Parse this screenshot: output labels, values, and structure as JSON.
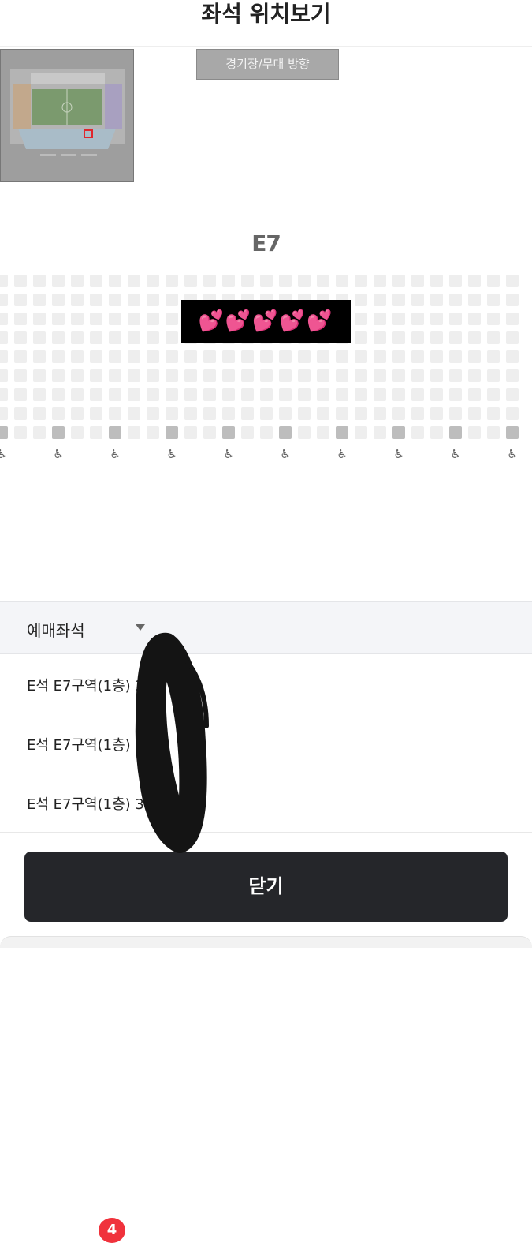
{
  "header": {
    "title": "좌석 위치보기"
  },
  "stage_button": {
    "label": "경기장/무대 방향"
  },
  "minimap": {
    "selected_highlight_color": "#e0262c"
  },
  "seatmap": {
    "section_label": "E7",
    "hearts": "💕💕💕💕💕",
    "seat_color": "#eeeeee",
    "accessible_seat_color": "#bdbdbd",
    "wheelchair_icon": "wheelchair-icon"
  },
  "booked": {
    "label": "예매좌석",
    "count": "4",
    "caret_icon": "caret-down-icon"
  },
  "seats": [
    {
      "text": "E석 E7구역(1층) 3"
    },
    {
      "text": "E석 E7구역(1층) 3"
    },
    {
      "text": "E석 E7구역(1층) 3열"
    }
  ],
  "close_button": {
    "label": "닫기"
  },
  "colors": {
    "badge": "#f0323c",
    "button": "#25262a"
  }
}
